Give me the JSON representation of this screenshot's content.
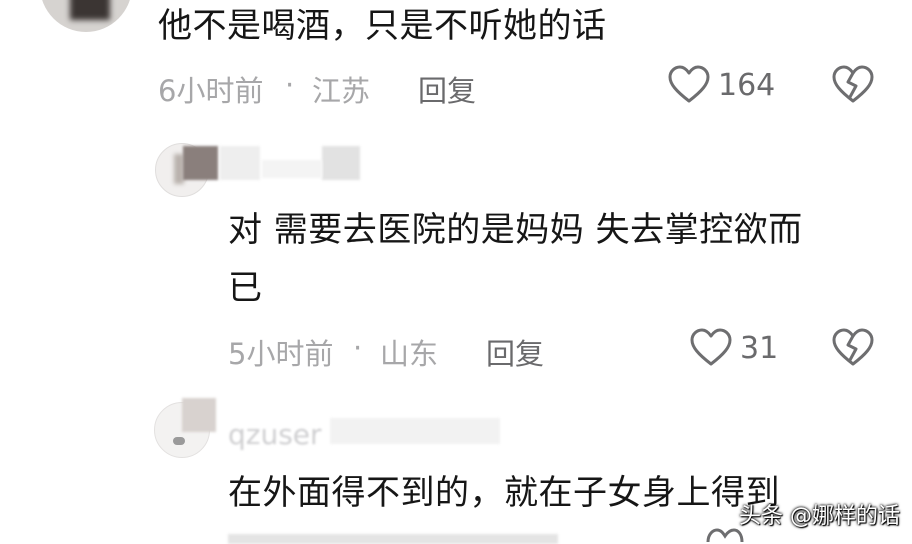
{
  "comments": [
    {
      "text": "他不是喝酒，只是不听她的话",
      "time": "6小时前",
      "location": "江苏",
      "reply_label": "回复",
      "likes": "164"
    },
    {
      "text_line1": "对 需要去医院的是妈妈 失去掌控欲而",
      "text_line2": "已",
      "time": "5小时前",
      "location": "山东",
      "reply_label": "回复",
      "likes": "31"
    },
    {
      "username_partial": "qzuser",
      "text": "在外面得不到的，就在子女身上得到"
    }
  ],
  "separator": "·",
  "watermark": "头条 @娜样的话",
  "icons": {
    "like": "heart-icon",
    "dislike": "broken-heart-icon"
  }
}
